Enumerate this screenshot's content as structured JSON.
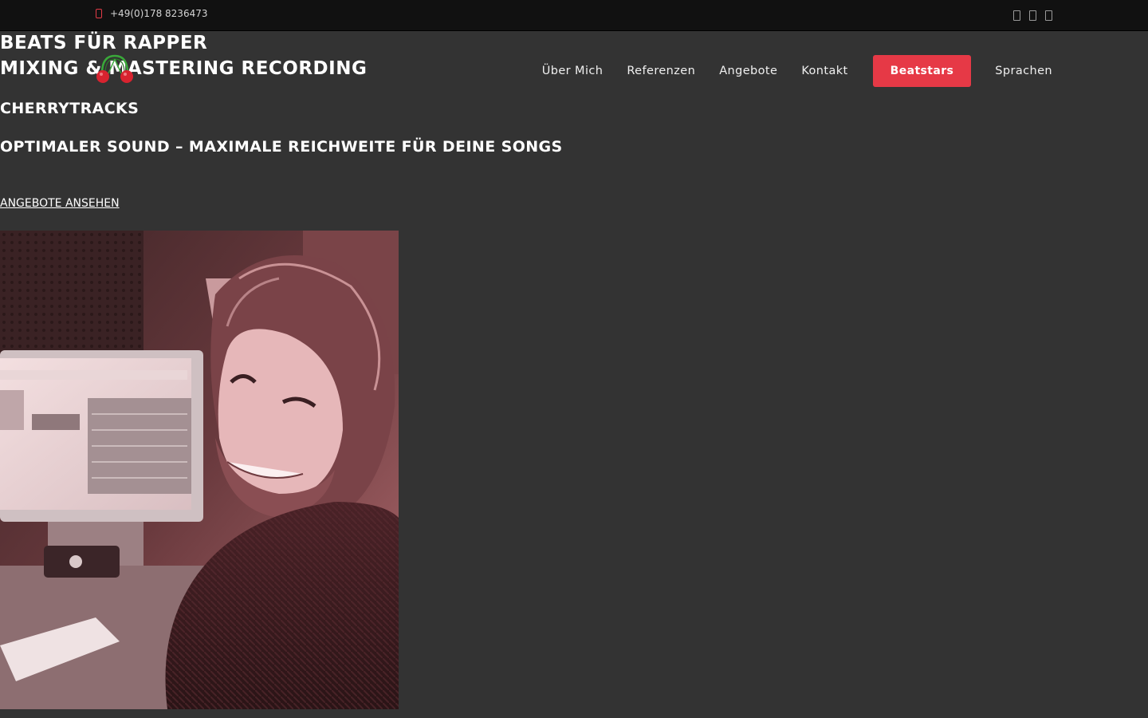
{
  "topbar": {
    "phone": "+49(0)178 8236473",
    "phone_icon": "phone-icon",
    "social_icons": [
      "facebook-icon",
      "instagram-icon",
      "youtube-icon"
    ]
  },
  "header": {
    "brand_line1": "BEATS FÜR RAPPER",
    "brand_line2": "MIXING & MASTERING RECORDING",
    "logo_icon": "cherry-headphones-logo"
  },
  "nav": {
    "items": [
      "Über Mich",
      "Referenzen",
      "Angebote",
      "Kontakt"
    ],
    "cta": "Beatstars",
    "language": "Sprachen"
  },
  "hero": {
    "site_name": "CHERRYTRACKS",
    "tagline": "OPTIMALER SOUND – MAXIMALE REICHWEITE FÜR DEINE SONGS",
    "cta_link": "ANGEBOTE ANSEHEN"
  },
  "colors": {
    "background": "#333333",
    "topbar": "#111111",
    "accent": "#e63946",
    "text": "#ffffff"
  }
}
